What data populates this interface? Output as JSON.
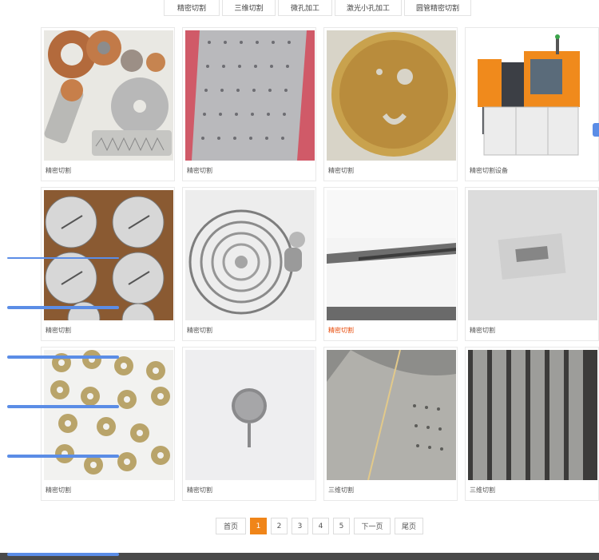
{
  "tabs": [
    "精密切割",
    "三维切割",
    "微孔加工",
    "激光小孔加工",
    "圆管精密切割"
  ],
  "products": [
    {
      "caption": "精密切割",
      "image": "metal-parts-photo"
    },
    {
      "caption": "精密切割",
      "image": "perforated-strip-photo"
    },
    {
      "caption": "精密切割",
      "image": "saw-blade-photo"
    },
    {
      "caption": "精密切割设备",
      "image": "laser-machine-photo"
    },
    {
      "caption": "精密切割",
      "image": "perforated-discs-photo"
    },
    {
      "caption": "精密切割",
      "image": "spiral-spring-photo"
    },
    {
      "caption": "精密切割",
      "image": "cut-strip-photo",
      "active": true
    },
    {
      "caption": "精密切割",
      "image": "micro-mesh-photo"
    },
    {
      "caption": "精密切割",
      "image": "brass-washers-photo"
    },
    {
      "caption": "精密切割",
      "image": "mesh-filter-photo"
    },
    {
      "caption": "三维切割",
      "image": "curved-sheet-photo"
    },
    {
      "caption": "三维切割",
      "image": "perforated-tubes-photo"
    }
  ],
  "pagination": {
    "first": "首页",
    "pages": [
      "1",
      "2",
      "3",
      "4",
      "5"
    ],
    "current": "1",
    "next": "下一页",
    "last": "尾页"
  },
  "colors": {
    "accent": "#f08519",
    "active_caption": "#e84c0b",
    "deco_blue": "#5b8de6"
  }
}
